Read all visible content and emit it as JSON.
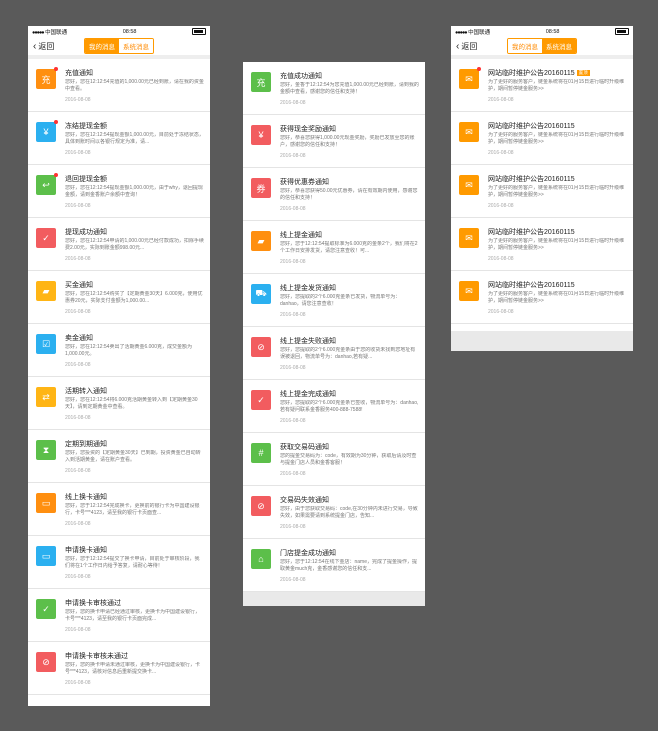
{
  "status": {
    "carrier": "中国联通",
    "time": "08:58"
  },
  "nav": {
    "back_label": "返回",
    "tab_my": "我的消息",
    "tab_system": "系统消息"
  },
  "screen1": [
    {
      "title": "充值通知",
      "desc": "您好，您在12:12:54充值的1,000.00元已经到账，请在我的资金中查看。",
      "date": "2016-08-08",
      "icon": "charge-icon",
      "color": "#ff8f10",
      "unread": true
    },
    {
      "title": "冻结提现金额",
      "desc": "您好，您在12:12:54提现金额1,000.00元，目前处于冻结状态，具体到账时间以各银行规定为准，请...",
      "date": "2016-08-08",
      "icon": "frozen-money-icon",
      "color": "#2bb0f0",
      "unread": true
    },
    {
      "title": "退回提现金额",
      "desc": "您好，您在12:12:54提现金额1,000.00元，由于why，退回提现金额，请到金香账户余额中查询！",
      "date": "2016-08-08",
      "icon": "refund-icon",
      "color": "#5cbf4a",
      "unread": true
    },
    {
      "title": "提现成功通知",
      "desc": "您好，您在12:12:54申请的1,000.00元已经付款成功，扣除手续费2.00元，实际到账金额998.00元...",
      "date": "2016-08-08",
      "icon": "withdraw-success-icon",
      "color": "#f25c5f",
      "unread": false
    },
    {
      "title": "买金通知",
      "desc": "您好，您在12:12:54购买了【定期黄金30天】6.000克，使用优惠券20元，实际支付金额为1,000.00...",
      "date": "2016-08-08",
      "icon": "gold-bar-icon",
      "color": "#ffb515",
      "unread": false
    },
    {
      "title": "卖金通知",
      "desc": "您好，您在12:12:54卖出了活期黄金6.000克，成交金额为1,000.00元。",
      "date": "2016-08-08",
      "icon": "sell-gold-icon",
      "color": "#2bb0f0",
      "unread": false
    },
    {
      "title": "活期转入通知",
      "desc": "您好，您在12:12:54将6.000克活期黄金转入到【定期黄金30天】，请到定期黄金中查看。",
      "date": "2016-08-08",
      "icon": "transfer-in-icon",
      "color": "#ffb515",
      "unread": false
    },
    {
      "title": "定期到期通知",
      "desc": "您好，您投资的【定期黄金30天】已到期，投资黄金已自动转入到活期黄金，请在账户查看。",
      "date": "2016-08-08",
      "icon": "hourglass-icon",
      "color": "#5cbf4a",
      "unread": false
    },
    {
      "title": "线上换卡通知",
      "desc": "您好，您于12:12:54完成换卡，更换前的银行卡为中国建设银行，卡号***4123，请至我的银行卡页面查...",
      "date": "2016-08-08",
      "icon": "card-swap-icon",
      "color": "#ff8f10",
      "unread": false
    },
    {
      "title": "申请换卡通知",
      "desc": "您好，您于12:12:54提交了换卡申请，目前处于审核阶段，我们将在1个工作日内给予答复，请耐心等待！",
      "date": "2016-08-08",
      "icon": "card-apply-icon",
      "color": "#2bb0f0",
      "unread": false
    },
    {
      "title": "申请换卡审核通过",
      "desc": "您好，您的换卡申请已经通过审核，更换卡为中国建设银行，卡号***4123，请至我的银行卡页面完成...",
      "date": "2016-08-08",
      "icon": "card-approved-icon",
      "color": "#5cbf4a",
      "unread": false
    },
    {
      "title": "申请换卡审核未通过",
      "desc": "您好，您的换卡申请未通过审核，更换卡为中国建设银行，卡号***4123，请核对信息后重新提交换卡...",
      "date": "2016-08-08",
      "icon": "card-rejected-icon",
      "color": "#f25c5f",
      "unread": false
    }
  ],
  "screen2": [
    {
      "title": "充值成功通知",
      "desc": "您好，金香于12:12:54为您充值1,000.00元已经到账，请到我的金额中查看，感谢您的信任和支持！",
      "date": "2016-08-08",
      "icon": "charge-icon",
      "color": "#5cbf4a"
    },
    {
      "title": "获得现金奖励通知",
      "desc": "您好，恭喜您获得1,000.00元现金奖励，奖励已发放至您的账户，感谢您的信任和支持！",
      "date": "2016-08-08",
      "icon": "cash-reward-icon",
      "color": "#f25c5f"
    },
    {
      "title": "获得优惠券通知",
      "desc": "您好，恭喜您获得50.00元优惠券，请在有效期内使用，感谢您的信任和支持！",
      "date": "2016-08-08",
      "icon": "coupon-icon",
      "color": "#f25c5f"
    },
    {
      "title": "线上提金通知",
      "desc": "您好，您于12:12:54提取标准为6.000克的金条2个，我们将在2个工作日安排发货，请您注意查收！可...",
      "date": "2016-08-08",
      "icon": "gold-pickup-icon",
      "color": "#ff8f10"
    },
    {
      "title": "线上提金发货通知",
      "desc": "您好，您提取的2个6.000克金条已发货，物流单号为：danhao，请您注意查收！",
      "date": "2016-08-08",
      "icon": "delivery-truck-icon",
      "color": "#2bb0f0"
    },
    {
      "title": "线上提金失败通知",
      "desc": "您好，您提取的2个6.000克金条由于您的收货未找到您地址有误被退回，物流单号为：danhao,若有疑...",
      "date": "2016-08-08",
      "icon": "delivery-failed-icon",
      "color": "#f25c5f"
    },
    {
      "title": "线上提金完成通知",
      "desc": "您好，您提取的2个6.000克金条已签收，物流单号为：danhao,若有疑问联系金香服务400-888-7588!",
      "date": "2016-08-08",
      "icon": "delivery-done-icon",
      "color": "#f25c5f"
    },
    {
      "title": "获取交易码通知",
      "desc": "您的提金交易码为：code，有效期为30分钟，获取后请及时查与提金门店人员和金香客服！",
      "date": "2016-08-08",
      "icon": "trade-code-icon",
      "color": "#5cbf4a"
    },
    {
      "title": "交易码失效通知",
      "desc": "您好，由于您获取交易码：code,在30分钟内未进行交易，导致失效，如果需要请到系统提金门店，告知...",
      "date": "2016-08-08",
      "icon": "code-expired-icon",
      "color": "#f25c5f"
    },
    {
      "title": "门店提金成功通知",
      "desc": "您好，您于12:12:54在线下金店：name，完成了提金操作，提取黄金much克，金香感谢您的信任和支...",
      "date": "2016-08-08",
      "icon": "store-icon",
      "color": "#5cbf4a"
    }
  ],
  "screen3": {
    "tag": "置顶",
    "items": [
      {
        "title": "网站临时维护公告20160115",
        "desc": "为了更好的服务客户，链金系统将在01月15日进行临时升级维护，期间暂停链金服务>>",
        "date": "2016-08-08",
        "icon": "announcement-icon",
        "color": "#ff9a00",
        "unread": true,
        "pinned": true
      },
      {
        "title": "网站临时维护公告20160115",
        "desc": "为了更好的服务客户，链金系统将在01月15日进行临时升级维护，期间暂停链金服务>>",
        "date": "2016-08-08",
        "icon": "announcement-icon",
        "color": "#ff9a00",
        "unread": false,
        "pinned": false
      },
      {
        "title": "网站临时维护公告20160115",
        "desc": "为了更好的服务客户，链金系统将在01月15日进行临时升级维护，期间暂停链金服务>>",
        "date": "2016-08-08",
        "icon": "announcement-icon",
        "color": "#ff9a00",
        "unread": false,
        "pinned": false
      },
      {
        "title": "网站临时维护公告20160115",
        "desc": "为了更好的服务客户，链金系统将在01月15日进行临时升级维护，期间暂停链金服务>>",
        "date": "2016-08-08",
        "icon": "announcement-icon",
        "color": "#ff9a00",
        "unread": false,
        "pinned": false
      },
      {
        "title": "网站临时维护公告20160115",
        "desc": "为了更好的服务客户，链金系统将在01月15日进行临时升级维护，期间暂停链金服务>>",
        "date": "2016-08-08",
        "icon": "announcement-icon",
        "color": "#ff9a00",
        "unread": false,
        "pinned": false
      }
    ]
  }
}
